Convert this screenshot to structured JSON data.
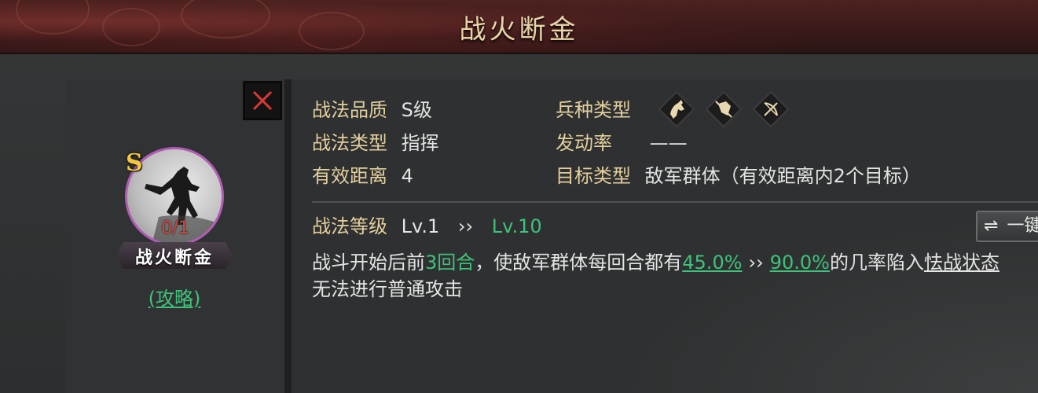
{
  "header": {
    "title": "战火断金"
  },
  "left": {
    "grade": "S",
    "count": "0/1",
    "skill_name": "战火断金",
    "guide_link": "(攻略)"
  },
  "info": {
    "quality_label": "战法品质",
    "quality_value": "S级",
    "type_label": "战法类型",
    "type_value": "指挥",
    "range_label": "有效距离",
    "range_value": "4",
    "troop_label": "兵种类型",
    "troop_icons": [
      "cavalry-icon",
      "shield-icon",
      "archer-icon"
    ],
    "trigger_label": "发动率",
    "trigger_value": "——",
    "target_label": "目标类型",
    "target_value": "敌军群体（有效距离内2个目标）"
  },
  "level": {
    "label": "战法等级",
    "current": "Lv.1",
    "arrow": "››",
    "max": "Lv.10",
    "button_icon": "⇌",
    "button_label": "一键"
  },
  "description": {
    "p1": "战斗开始后前",
    "turns": "3回合",
    "p2": "，使敌军群体每回合都有",
    "rate_min": "45.0%",
    "arrow": "››",
    "rate_max": "90.0%",
    "p3": "的几率陷入",
    "status": "怯战状态",
    "line2": "无法进行普通攻击"
  },
  "colors": {
    "label_gold": "#e3cf9d",
    "value_white": "#e4e4e4",
    "highlight_green": "#3fc27a",
    "count_red": "#d6453c",
    "grade_gold": "#f3c642",
    "avatar_ring": "#b25bb4"
  }
}
